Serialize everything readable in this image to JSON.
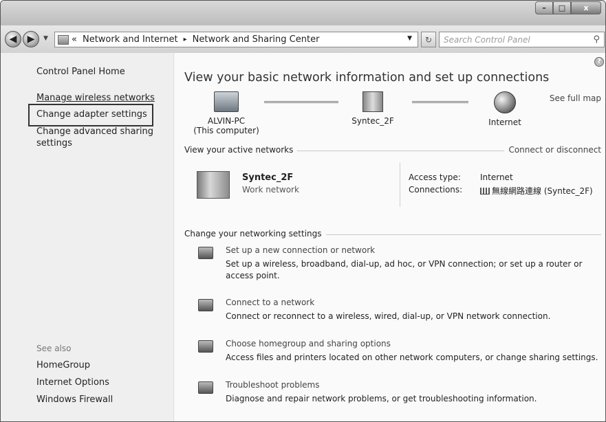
{
  "window": {
    "caption_buttons": {
      "minimize": "–",
      "maximize": "□",
      "close": "x"
    }
  },
  "nav": {
    "back_glyph": "◀",
    "forward_glyph": "▶",
    "address_segments": [
      "«",
      "Network and Internet",
      "Network and Sharing Center"
    ],
    "address_sep": "▸",
    "search_placeholder": "Search Control Panel",
    "search_icon": "search-icon",
    "refresh_icon": "refresh-icon"
  },
  "sidebar": {
    "home": "Control Panel Home",
    "tasks": [
      {
        "label": "Manage wireless networks"
      },
      {
        "label": "Change adapter settings"
      },
      {
        "label": "Change advanced sharing settings"
      }
    ],
    "see_also_label": "See also",
    "see_also": [
      {
        "label": "HomeGroup"
      },
      {
        "label": "Internet Options"
      },
      {
        "label": "Windows Firewall"
      }
    ]
  },
  "main": {
    "help_glyph": "?",
    "heading": "View your basic network information and set up connections",
    "see_full_map": "See full map",
    "map": {
      "computer_name": "ALVIN-PC",
      "computer_sub": "(This computer)",
      "network_name": "Syntec_2F",
      "internet_name": "Internet"
    },
    "active_networks": {
      "label": "View your active networks",
      "connect_link": "Connect or disconnect",
      "network_name": "Syntec_2F",
      "network_type": "Work network",
      "access_type_label": "Access type:",
      "access_type_value": "Internet",
      "connections_label": "Connections:",
      "connections_value": "無線網路連線 (Syntec_2F)"
    },
    "change_settings": {
      "label": "Change your networking settings",
      "tasks": [
        {
          "title": "Set up a new connection or network",
          "desc": "Set up a wireless, broadband, dial-up, ad hoc, or VPN connection; or set up a router or access point."
        },
        {
          "title": "Connect to a network",
          "desc": "Connect or reconnect to a wireless, wired, dial-up, or VPN network connection."
        },
        {
          "title": "Choose homegroup and sharing options",
          "desc": "Access files and printers located on other network computers, or change sharing settings."
        },
        {
          "title": "Troubleshoot problems",
          "desc": "Diagnose and repair network problems, or get troubleshooting information."
        }
      ]
    }
  }
}
